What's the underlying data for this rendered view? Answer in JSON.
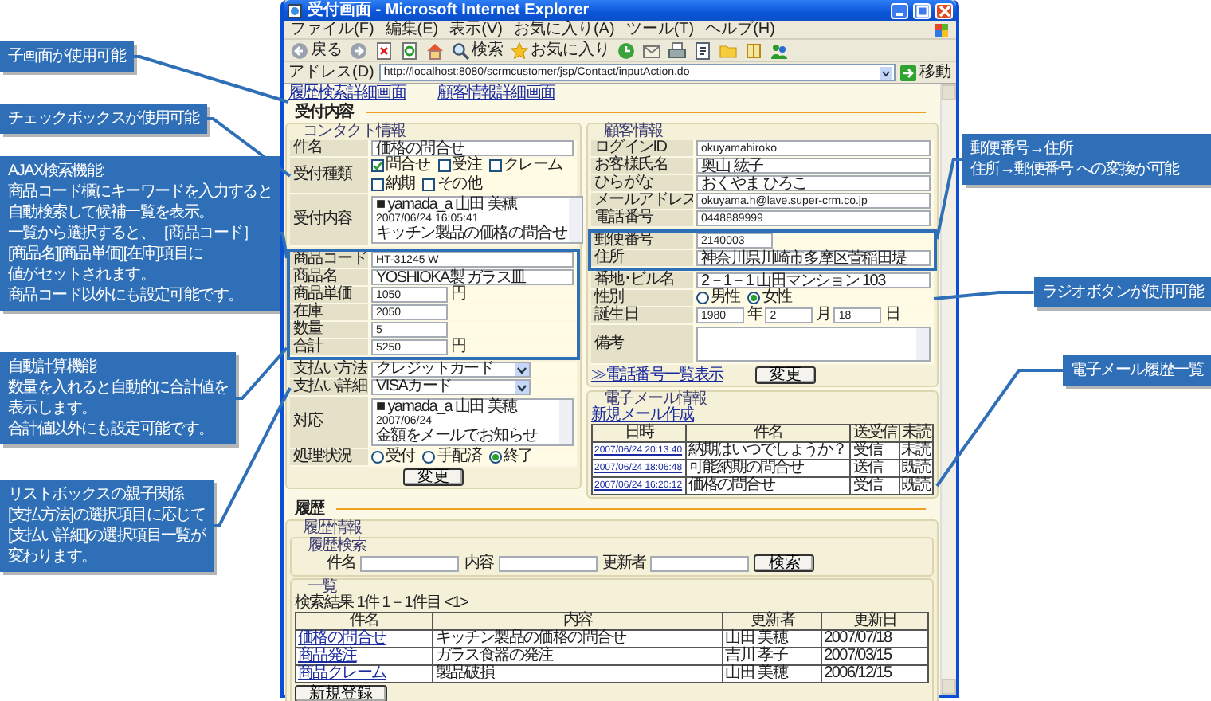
{
  "callouts_left": [
    {
      "lines": [
        "子画面が使用可能"
      ]
    },
    {
      "lines": [
        "チェックボックスが使用可能"
      ]
    },
    {
      "lines": [
        "AJAX検索機能:",
        "商品コード欄にキーワードを入力すると",
        "自動検索して候補一覧を表示。",
        "一覧から選択すると、［商品コード］",
        "[商品名][商品単価][在庫]項目に",
        "値がセットされます。",
        "商品コード以外にも設定可能です。"
      ]
    },
    {
      "lines": [
        "自動計算機能",
        "数量を入れると自動的に合計値を",
        "表示します。",
        "合計値以外にも設定可能です。"
      ]
    },
    {
      "lines": [
        "リストボックスの親子関係",
        "[支払方法]の選択項目に応じて",
        "[支払い詳細]の選択項目一覧が",
        "変わります。"
      ]
    }
  ],
  "callouts_right": [
    {
      "lines": [
        "郵便番号→住所",
        "住所→郵便番号 への変換が可能"
      ]
    },
    {
      "lines": [
        "ラジオボタンが使用可能"
      ]
    },
    {
      "lines": [
        "電子メール履歴一覧"
      ]
    }
  ],
  "window": {
    "title": "受付画面 - Microsoft Internet Explorer",
    "menu": [
      "ファイル(F)",
      "編集(E)",
      "表示(V)",
      "お気に入り(A)",
      "ツール(T)",
      "ヘルプ(H)"
    ],
    "toolbar": [
      {
        "kind": "back",
        "label": "戻る"
      },
      {
        "kind": "forward"
      },
      {
        "kind": "stop"
      },
      {
        "kind": "refresh"
      },
      {
        "kind": "home"
      },
      {
        "kind": "search",
        "label": "検索"
      },
      {
        "kind": "favorites",
        "label": "お気に入り"
      },
      {
        "kind": "history"
      },
      {
        "kind": "mail"
      },
      {
        "kind": "print"
      },
      {
        "kind": "edit"
      },
      {
        "kind": "folder"
      },
      {
        "kind": "research"
      },
      {
        "kind": "messenger"
      }
    ],
    "address": {
      "label": "アドレス(D)",
      "url": "http://localhost:8080/scrmcustomer/jsp/Contact/inputAction.do",
      "go": "移動"
    }
  },
  "page": {
    "links": [
      "履歴検索詳細画面",
      "顧客情報詳細画面"
    ],
    "reception": {
      "heading": "受付内容",
      "contact": {
        "legend": "コンタクト情報",
        "button": "変更",
        "rows": [
          {
            "kind": "text",
            "label": "件名",
            "value": "価格の問合せ",
            "framed": false
          },
          {
            "kind": "checks",
            "label": "受付種類",
            "framed": false,
            "options": [
              {
                "label": "問合せ",
                "checked": true
              },
              {
                "label": "受注",
                "checked": false
              },
              {
                "label": "クレーム",
                "checked": false
              },
              {
                "label": "納期",
                "checked": false
              },
              {
                "label": "その他",
                "checked": false
              }
            ]
          },
          {
            "kind": "area",
            "label": "受付内容",
            "framed": false,
            "lines": [
              "■ yamada_a 山田 美穂",
              "2007/06/24 16:05:41",
              "キッチン製品の価格の問合せ"
            ]
          },
          {
            "kind": "text",
            "label": "商品コード",
            "value": "HT-31245 W",
            "framed": true
          },
          {
            "kind": "text",
            "label": "商品名",
            "value": "YOSHIOKA製 ガラス皿",
            "framed": true
          },
          {
            "kind": "short",
            "label": "商品単価",
            "framed": true,
            "parts": [
              {
                "value": "1050",
                "unit": "円"
              }
            ]
          },
          {
            "kind": "short",
            "label": "在庫",
            "framed": true,
            "parts": [
              {
                "value": "2050"
              }
            ]
          },
          {
            "kind": "short",
            "label": "数量",
            "framed": true,
            "parts": [
              {
                "value": "5"
              }
            ]
          },
          {
            "kind": "short",
            "label": "合計",
            "framed": true,
            "parts": [
              {
                "value": "5250",
                "unit": "円"
              }
            ]
          },
          {
            "kind": "select",
            "label": "支払い方法",
            "value": "クレジットカード",
            "framed": false
          },
          {
            "kind": "select",
            "label": "支払い詳細",
            "value": "VISAカード",
            "framed": false
          },
          {
            "kind": "area",
            "label": "対応",
            "framed": false,
            "lines": [
              "■ yamada_a 山田 美穂",
              "2007/06/24",
              "金額をメールでお知らせ"
            ]
          },
          {
            "kind": "radios",
            "label": "処理状況",
            "framed": false,
            "options": [
              {
                "label": "受付",
                "selected": false
              },
              {
                "label": "手配済",
                "selected": false
              },
              {
                "label": "終了",
                "selected": true
              }
            ]
          }
        ]
      },
      "customer": {
        "legend": "顧客情報",
        "link": "≫電話番号一覧表示",
        "button": "変更",
        "rows": [
          {
            "kind": "text",
            "label": "ログインID",
            "value": "okuyamahiroko",
            "framed": false
          },
          {
            "kind": "text",
            "label": "お客様氏名",
            "value": "奥山 紘子",
            "framed": false
          },
          {
            "kind": "text",
            "label": "ひらがな",
            "value": "おくやま ひろこ",
            "framed": false
          },
          {
            "kind": "text",
            "label": "メールアドレス",
            "value": "okuyama.h@lave.super-crm.co.jp",
            "framed": false
          },
          {
            "kind": "text",
            "label": "電話番号",
            "value": "0448889999",
            "framed": false
          },
          {
            "kind": "short",
            "label": "郵便番号",
            "framed": true,
            "parts": [
              {
                "value": "2140003"
              }
            ]
          },
          {
            "kind": "text",
            "label": "住所",
            "value": "神奈川県川崎市多摩区菅稲田堤",
            "framed": true
          },
          {
            "kind": "text",
            "label": "番地･ビル名",
            "value": "2－1－1 山田マンション 103",
            "framed": false
          },
          {
            "kind": "radios",
            "label": "性別",
            "framed": false,
            "options": [
              {
                "label": "男性",
                "selected": false
              },
              {
                "label": "女性",
                "selected": true
              }
            ]
          },
          {
            "kind": "short",
            "label": "誕生日",
            "framed": false,
            "parts": [
              {
                "value": "1980",
                "unit": "年"
              },
              {
                "value": "2",
                "unit": "月"
              },
              {
                "value": "18",
                "unit": "日"
              }
            ]
          },
          {
            "kind": "area",
            "label": "備考",
            "framed": false
          }
        ]
      },
      "email": {
        "legend": "電子メール情報",
        "link": "新規メール作成",
        "columns": [
          "日時",
          "件名",
          "送受信",
          "未読"
        ],
        "rows": [
          [
            "2007/06/24 20:13:40",
            "納期はいつでしょうか？",
            "受信",
            "未読"
          ],
          [
            "2007/06/24 18:06:48",
            "可能納期の問合せ",
            "送信",
            "既読"
          ],
          [
            "2007/06/24 16:20:12",
            "価格の問合せ",
            "受信",
            "既読"
          ]
        ]
      }
    },
    "history": {
      "heading": "履歴",
      "legend": "履歴情報",
      "search": {
        "legend": "履歴検索",
        "fields": [
          "件名",
          "内容",
          "更新者"
        ],
        "button": "検索"
      },
      "list": {
        "legend": "一覧",
        "summary": "検索結果 1件 1－1件目 <1>",
        "columns": [
          "件名",
          "内容",
          "更新者",
          "更新日"
        ],
        "rows": [
          [
            "価格の問合せ",
            "キッチン製品の価格の問合せ",
            "山田 美穂",
            "2007/07/18"
          ],
          [
            "商品発注",
            "ガラス食器の発注",
            "吉川 孝子",
            "2007/03/15"
          ],
          [
            "商品クレーム",
            "製品破損",
            "山田 美穂",
            "2006/12/15"
          ]
        ],
        "button": "新規登録"
      }
    }
  }
}
